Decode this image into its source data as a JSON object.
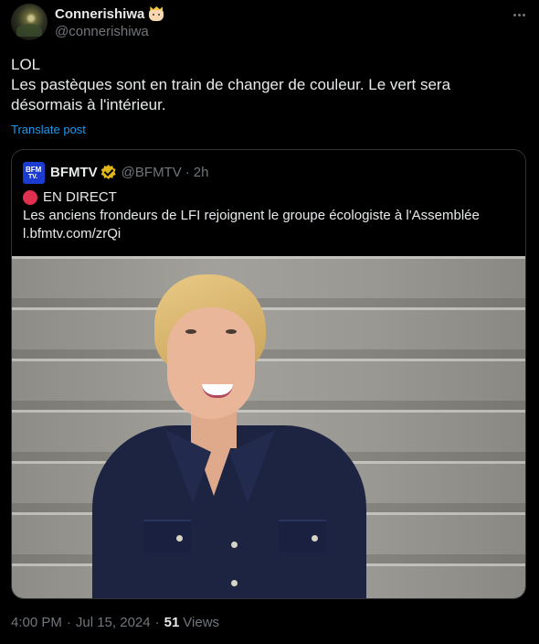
{
  "author": {
    "display_name": "Connerishiwa",
    "handle": "@connerishiwa",
    "name_emoji": "cook-emoji"
  },
  "tweet": {
    "lines": [
      "LOL",
      "Les pastèques sont en train de changer de couleur. Le vert sera désormais à l'intérieur."
    ],
    "translate_label": "Translate post"
  },
  "quote": {
    "avatar_text_1": "BFM",
    "avatar_text_2": "TV.",
    "display_name": "BFMTV",
    "handle": "@BFMTV",
    "separator": "·",
    "time": "2h",
    "live_label": "EN DIRECT",
    "headline": "Les anciens frondeurs de LFI rejoignent le groupe écologiste à l'Assemblée",
    "link": "l.bfmtv.com/zrQi"
  },
  "meta": {
    "time": "4:00 PM",
    "separator": "·",
    "date": "Jul 15, 2024",
    "views_count": "51",
    "views_label": "Views"
  },
  "colors": {
    "background": "#000000",
    "text": "#e7e9ea",
    "muted": "#71767b",
    "link": "#1d9bf0",
    "verified_gold": "#e2b719",
    "live_red": "#e0304e"
  }
}
